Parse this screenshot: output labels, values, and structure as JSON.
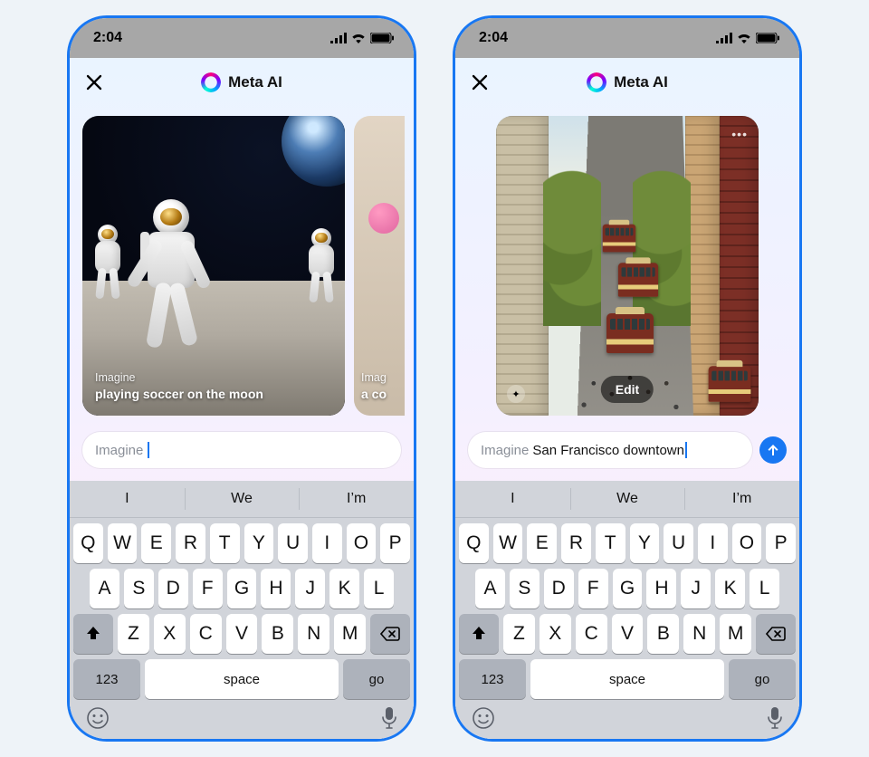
{
  "status_bar": {
    "time": "2:04"
  },
  "header": {
    "title": "Meta AI"
  },
  "phones": [
    {
      "cards": [
        {
          "prefix": "Imagine",
          "caption": "playing soccer on the moon"
        },
        {
          "prefix": "Imag",
          "caption": "a co"
        }
      ],
      "input": {
        "prefix": "Imagine",
        "value": ""
      }
    },
    {
      "card": {
        "edit_label": "Edit"
      },
      "input": {
        "prefix": "Imagine",
        "value": "San Francisco downtown"
      }
    }
  ],
  "keyboard": {
    "suggestions": [
      "I",
      "We",
      "I’m"
    ],
    "row1": [
      "Q",
      "W",
      "E",
      "R",
      "T",
      "Y",
      "U",
      "I",
      "O",
      "P"
    ],
    "row2": [
      "A",
      "S",
      "D",
      "F",
      "G",
      "H",
      "J",
      "K",
      "L"
    ],
    "row3": [
      "Z",
      "X",
      "C",
      "V",
      "B",
      "N",
      "M"
    ],
    "numbers": "123",
    "space": "space",
    "go": "go"
  }
}
